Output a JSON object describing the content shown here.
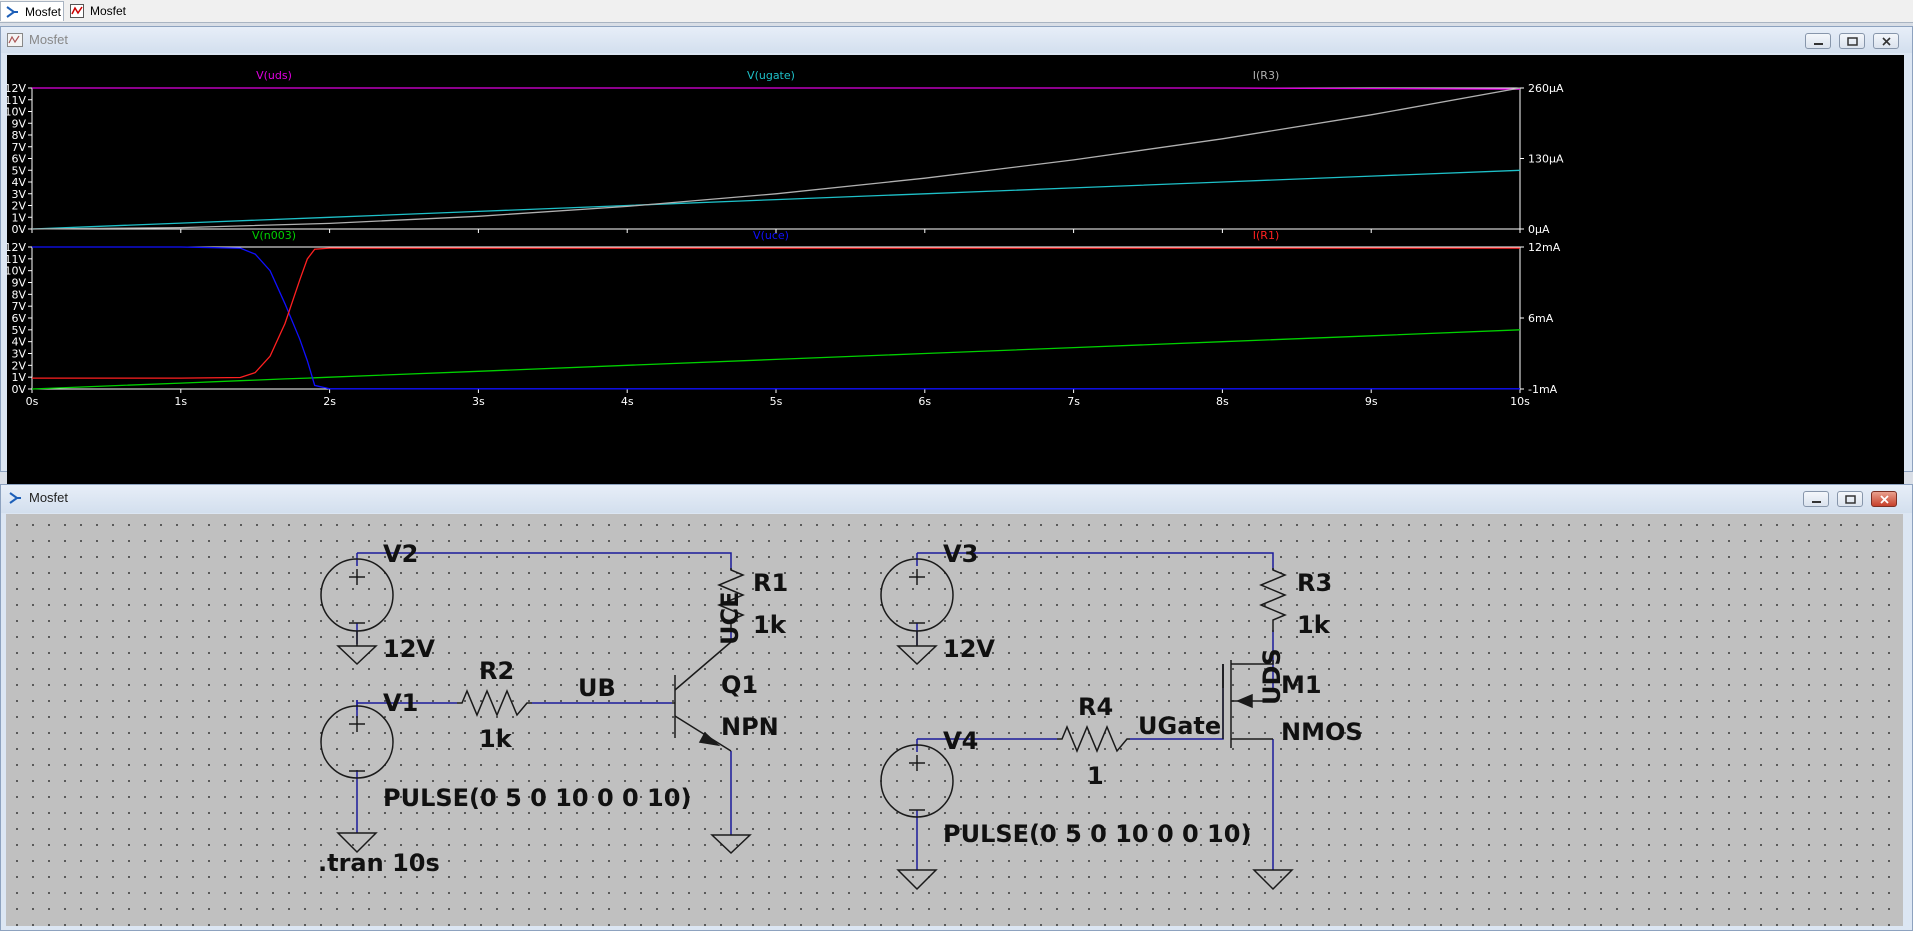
{
  "tabs": [
    {
      "label": "Mosfet",
      "icon": "schematic-icon",
      "active": true
    },
    {
      "label": "Mosfet",
      "icon": "waveform-icon",
      "active": false
    }
  ],
  "waveform_window": {
    "title": "Mosfet"
  },
  "schematic_window": {
    "title": "Mosfet"
  },
  "colors": {
    "uds": "#e000e0",
    "ugate": "#1ec0c8",
    "ir3": "#b0b0b0",
    "n003": "#00d000",
    "uce": "#1010ff",
    "ir1": "#ff2020",
    "axis": "#ffffff",
    "wire": "#1010a0",
    "component": "#1a1a1a"
  },
  "chart_data": [
    {
      "type": "line",
      "pane": "top",
      "x": [
        0,
        1,
        2,
        3,
        4,
        5,
        6,
        7,
        8,
        9,
        10
      ],
      "xlim": [
        0,
        10
      ],
      "yleft_ticks": [
        "0V",
        "1V",
        "2V",
        "3V",
        "4V",
        "5V",
        "6V",
        "7V",
        "8V",
        "9V",
        "10V",
        "11V",
        "12V"
      ],
      "yleft_lim": [
        0,
        12
      ],
      "yright_ticks": [
        "0µA",
        "130µA",
        "260µA"
      ],
      "yright_lim": [
        0,
        260
      ],
      "series": [
        {
          "name": "V(uds)",
          "axis": "left",
          "color": "#e000e0",
          "values": [
            12,
            12,
            12,
            12,
            12,
            12,
            12,
            12,
            12,
            11.95,
            11.9
          ]
        },
        {
          "name": "V(ugate)",
          "axis": "left",
          "color": "#1ec0c8",
          "values": [
            0,
            0.5,
            1,
            1.5,
            2,
            2.5,
            3,
            3.5,
            4,
            4.5,
            5
          ]
        },
        {
          "name": "I(R3)",
          "axis": "right",
          "color": "#b0b0b0",
          "values": [
            0,
            2.6,
            10.4,
            23.4,
            41.6,
            65,
            93.6,
            127.4,
            166.4,
            210.6,
            260
          ]
        }
      ]
    },
    {
      "type": "line",
      "pane": "bottom",
      "x": [
        0,
        0.5,
        1,
        1.4,
        1.5,
        1.6,
        1.7,
        1.8,
        1.85,
        1.9,
        2,
        3,
        4,
        5,
        6,
        7,
        8,
        9,
        10
      ],
      "xlim": [
        0,
        10
      ],
      "xticks": [
        "0s",
        "1s",
        "2s",
        "3s",
        "4s",
        "5s",
        "6s",
        "7s",
        "8s",
        "9s",
        "10s"
      ],
      "yleft_ticks": [
        "0V",
        "1V",
        "2V",
        "3V",
        "4V",
        "5V",
        "6V",
        "7V",
        "8V",
        "9V",
        "10V",
        "11V",
        "12V"
      ],
      "yleft_lim": [
        0,
        12
      ],
      "yright_ticks": [
        "-1mA",
        "6mA",
        "12mA"
      ],
      "yright_lim": [
        -1,
        12
      ],
      "series": [
        {
          "name": "V(n003)",
          "axis": "left",
          "color": "#00d000",
          "values": [
            0,
            0.25,
            0.5,
            0.7,
            0.75,
            0.8,
            0.85,
            0.9,
            0.925,
            0.95,
            1,
            1.5,
            2,
            2.5,
            3,
            3.5,
            4,
            4.5,
            5
          ]
        },
        {
          "name": "V(uce)",
          "axis": "left",
          "color": "#1010ff",
          "values": [
            12,
            12,
            12,
            11.9,
            11.4,
            10,
            7.2,
            4.2,
            2.4,
            0.3,
            0.02,
            0.02,
            0.02,
            0.02,
            0.02,
            0.02,
            0.02,
            0.02,
            0.02
          ]
        },
        {
          "name": "I(R1)",
          "axis": "right",
          "color": "#ff2020",
          "values": [
            0,
            0,
            0,
            0.05,
            0.5,
            2,
            5,
            9,
            10.9,
            11.8,
            11.9,
            11.9,
            11.9,
            11.9,
            11.9,
            11.9,
            11.9,
            11.9,
            11.9
          ]
        }
      ]
    }
  ],
  "schematic": {
    "v2": {
      "name": "V2",
      "value": "12V"
    },
    "r1": {
      "name": "R1",
      "value": "1k"
    },
    "uce_label": "UCE",
    "v1": {
      "name": "V1",
      "value": "PULSE(0 5 0 10 0 0 10)"
    },
    "r2": {
      "name": "R2",
      "value": "1k"
    },
    "ub_label": "UB",
    "q1": {
      "name": "Q1",
      "value": "NPN"
    },
    "tran": ".tran 10s",
    "v3": {
      "name": "V3",
      "value": "12V"
    },
    "r3": {
      "name": "R3",
      "value": "1k"
    },
    "uds_label": "UDS",
    "m1": {
      "name": "M1",
      "value": "NMOS"
    },
    "v4": {
      "name": "V4",
      "value": "PULSE(0 5 0 10 0 0 10)"
    },
    "r4": {
      "name": "R4",
      "value": "1"
    },
    "ugate_label": "UGate"
  }
}
